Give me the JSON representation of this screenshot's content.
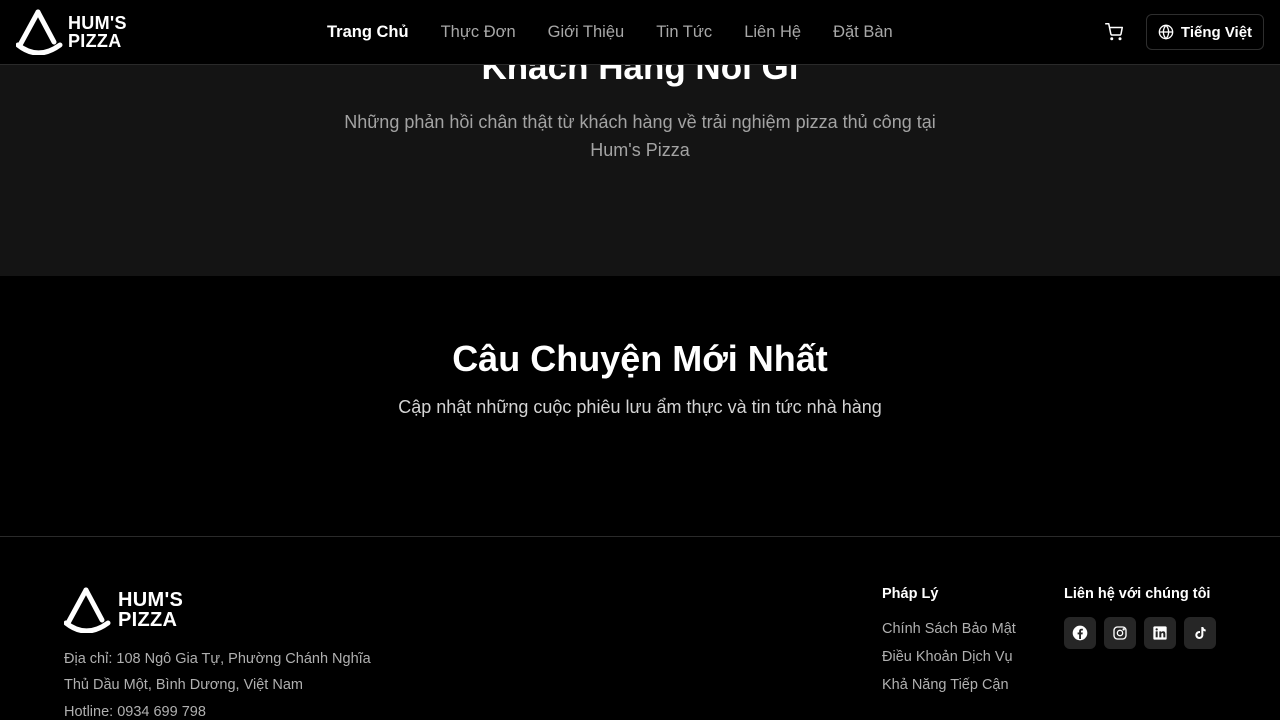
{
  "header": {
    "logo_line1": "HUM'S",
    "logo_line2": "PIZZA",
    "nav": [
      {
        "label": "Trang Chủ"
      },
      {
        "label": "Thực Đơn"
      },
      {
        "label": "Giới Thiệu"
      },
      {
        "label": "Tin Tức"
      },
      {
        "label": "Liên Hệ"
      },
      {
        "label": "Đặt Bàn"
      }
    ],
    "active_nav": "Trang Chủ",
    "cart_icon": "shopping-cart-icon",
    "language_icon": "globe-icon",
    "language_label": "Tiếng Việt"
  },
  "testimonials": {
    "title": "Khách Hàng Nói Gì",
    "subtitle_line1": "Những phản hồi chân thật từ khách hàng về trải nghiệm pizza thủ công tại",
    "subtitle_line2": "Hum's Pizza"
  },
  "stories": {
    "title": "Câu Chuyện Mới Nhất",
    "subtitle": "Cập nhật những cuộc phiêu lưu ẩm thực và tin tức nhà hàng"
  },
  "footer": {
    "logo_line1": "HUM'S",
    "logo_line2": "PIZZA",
    "address_line1": "Địa chỉ: 108 Ngô Gia Tự, Phường Chánh Nghĩa",
    "address_line2": "Thủ Dầu Một, Bình Dương, Việt Nam",
    "hotline": "Hotline: 0934 699 798",
    "legal": {
      "title": "Pháp Lý",
      "links": [
        "Chính Sách Bảo Mật",
        "Điều Khoản Dịch Vụ",
        "Khả Năng Tiếp Cận"
      ]
    },
    "contact": {
      "title": "Liên hệ với chúng tôi",
      "socials": [
        "facebook-icon",
        "instagram-icon",
        "linkedin-icon",
        "tiktok-icon"
      ]
    }
  },
  "colors": {
    "background": "#000000",
    "section_dark": "#141414",
    "muted_text": "#a3a3a3",
    "social_bg": "#262626"
  }
}
